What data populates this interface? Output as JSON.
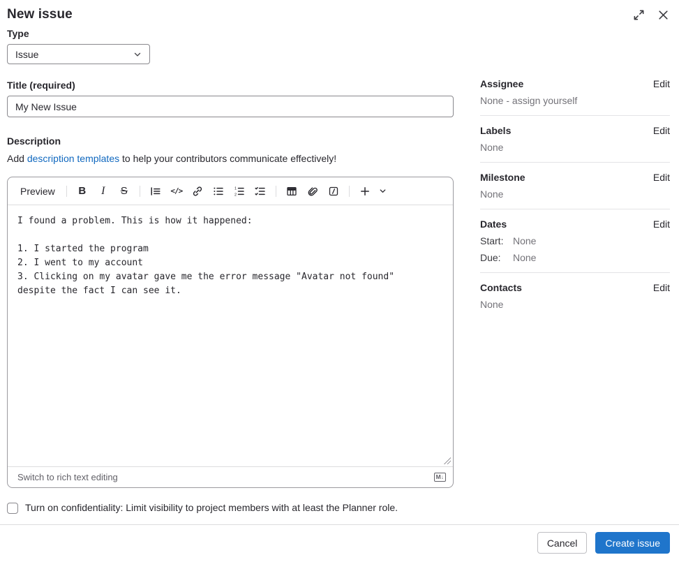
{
  "header": {
    "title": "New issue"
  },
  "form": {
    "type": {
      "label": "Type",
      "value": "Issue"
    },
    "title": {
      "label": "Title (required)",
      "value": "My New Issue"
    },
    "description": {
      "label": "Description",
      "hint_prefix": "Add ",
      "hint_link": "description templates",
      "hint_suffix": " to help your contributors communicate effectively!"
    },
    "editor": {
      "preview_label": "Preview",
      "bold_glyph": "B",
      "italic_glyph": "I",
      "strike_glyph": "S",
      "code_glyph": "</>",
      "toolbar_icon_names": [
        "quote-icon",
        "code-icon",
        "link-icon",
        "bullet-list-icon",
        "numbered-list-icon",
        "task-list-icon",
        "table-icon",
        "paperclip-icon",
        "quick-action-icon",
        "plus-icon",
        "chevron-down-icon"
      ],
      "content": "I found a problem. This is how it happened:\n\n1. I started the program\n2. I went to my account\n3. Clicking on my avatar gave me the error message \"Avatar not found\"\ndespite the fact I can see it.",
      "switch_label": "Switch to rich text editing",
      "markdown_badge": "M↓"
    },
    "confidentiality": {
      "label": "Turn on confidentiality: Limit visibility to project members with at least the Planner role.",
      "checked": false
    }
  },
  "sidebar": {
    "sections": [
      {
        "title": "Assignee",
        "action": "Edit",
        "value": "None - assign yourself"
      },
      {
        "title": "Labels",
        "action": "Edit",
        "value": "None"
      },
      {
        "title": "Milestone",
        "action": "Edit",
        "value": "None"
      },
      {
        "title": "Dates",
        "action": "Edit",
        "rows": [
          {
            "label": "Start:",
            "value": "None"
          },
          {
            "label": "Due:",
            "value": "None"
          }
        ]
      },
      {
        "title": "Contacts",
        "action": "Edit",
        "value": "None"
      }
    ]
  },
  "footer": {
    "cancel_label": "Cancel",
    "submit_label": "Create issue"
  },
  "colors": {
    "accent_blue": "#1f75cb",
    "link_blue": "#1068bf",
    "text_primary": "#28272d",
    "text_secondary": "#737278",
    "input_border": "#89888d",
    "divider": "#dcdcde"
  }
}
